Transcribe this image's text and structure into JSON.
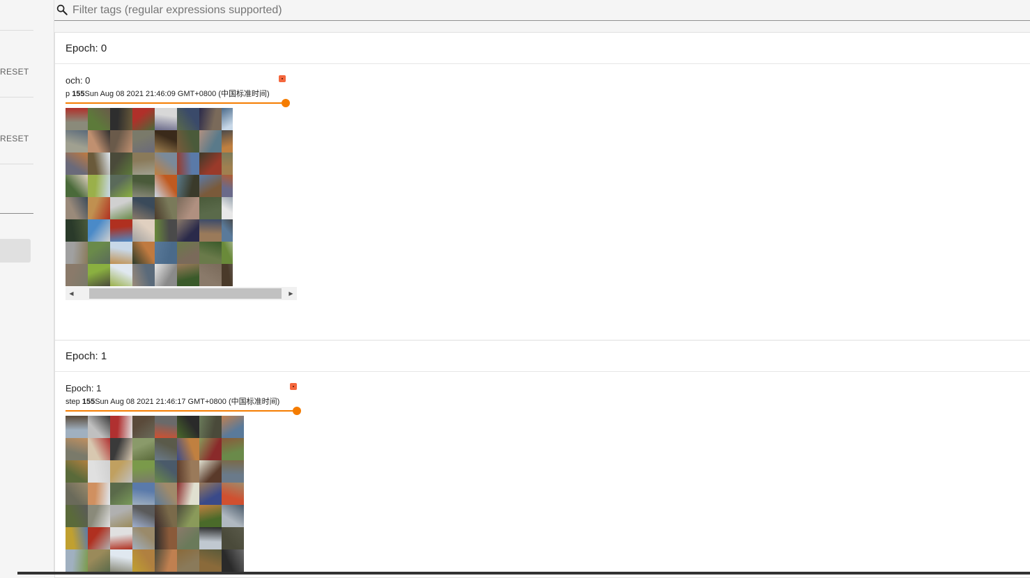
{
  "sidebar": {
    "reset_1": "RESET",
    "reset_2": "RESET"
  },
  "search": {
    "placeholder": "Filter tags (regular expressions supported)"
  },
  "groups": [
    {
      "header": "Epoch: 0",
      "card": {
        "title": "och: 0",
        "step_label": "p",
        "step_value": "155",
        "timestamp": "Sun Aug 08 2021 21:46:09 GMT+0800 (中国标准时间)",
        "slider_fraction": 1.0
      }
    },
    {
      "header": "Epoch: 1",
      "card": {
        "title": "Epoch: 1",
        "step_label": "step",
        "step_value": "155",
        "timestamp": "Sun Aug 08 2021 21:46:17 GMT+0800 (中国标准时间)",
        "slider_fraction": 1.0
      }
    }
  ],
  "icons": {
    "search": "search-icon",
    "fullscreen": "fullscreen-icon",
    "scroll_left": "scroll-left-arrow",
    "scroll_right": "scroll-right-arrow"
  },
  "colors": {
    "accent": "#f57c00",
    "fullscreen_button": "#f4673d"
  },
  "image_palette_0": [
    "#8a8a7a",
    "#5d7a3a",
    "#2e2e2e",
    "#b0302a",
    "#d8d8d8",
    "#3a4a6a",
    "#7a6a5a",
    "#c8d8e8",
    "#a0a090",
    "#c09070",
    "#6a5a4a",
    "#7a7a6a",
    "#3a2a1a",
    "#4a5a3a",
    "#5a7a8a",
    "#c08040",
    "#6a6a7a",
    "#6a5a3a",
    "#4a4a3a",
    "#8a7a5a",
    "#7a8a9a",
    "#5a7aa8",
    "#9a3a2a",
    "#a08050",
    "#4a6a3a",
    "#9ab04a",
    "#5a6a5a",
    "#4a5a3a",
    "#c05a20",
    "#3a3a2a",
    "#7a5a3a",
    "#6a6a8a",
    "#9a8a7a",
    "#c09050",
    "#d0d0d0",
    "#3a4a5a",
    "#7a7a5a",
    "#b09080",
    "#5a6a4a",
    "#e8e8e8",
    "#2a3a2a",
    "#4a8ac8",
    "#b03020",
    "#e0d0c0",
    "#4a4a4a",
    "#2a2a4a",
    "#9a7a5a",
    "#5a7a9a",
    "#a0a0a0",
    "#6a8a4a",
    "#c8d8e8",
    "#c07a40",
    "#4a6a8a",
    "#7a6a5a",
    "#6a7a4a",
    "#6a8a3a",
    "#8a7a6a",
    "#8ab040",
    "#e0e8f0",
    "#5a6a7a",
    "#8a8a8a",
    "#3a5a2a",
    "#8a7a6a",
    "#4a3a2a"
  ],
  "image_palette_1": [
    "#a0b0c0",
    "#c0c0c0",
    "#b03030",
    "#5a4a3a",
    "#6a6a6a",
    "#2a2a2a",
    "#4a4a3a",
    "#5a7a9a",
    "#7a7a6a",
    "#d8c8b0",
    "#3a3a3a",
    "#8a9a6a",
    "#5a5a4a",
    "#c08040",
    "#8a2a2a",
    "#6a8a4a",
    "#5a6a3a",
    "#e0e0e0",
    "#c0a060",
    "#7a9a4a",
    "#4a5a6a",
    "#9a7a5a",
    "#5a3a2a",
    "#6a7a8a",
    "#6a6a5a",
    "#d09060",
    "#5a6a4a",
    "#5a7aaa",
    "#a08a6a",
    "#e0e0d0",
    "#3a4a8a",
    "#d05030",
    "#5a6a3a",
    "#8a8a7a",
    "#b0b0b0",
    "#5a5a5a",
    "#7a6a4a",
    "#8a9a5a",
    "#4a6a2a",
    "#b0b8c0",
    "#c0a030",
    "#b03020",
    "#e0e0e0",
    "#9a8a6a",
    "#8a5a3a",
    "#6a7a5a",
    "#c0c8d0",
    "#4a4a3a",
    "#a0b0c0",
    "#9a8a5a",
    "#e0e8f0",
    "#b08040",
    "#c08050",
    "#8a7a5a",
    "#8a6a3a",
    "#2a2a2a",
    "#a0b0d0",
    "#7a9a5a",
    "#d0d0d0",
    "#c09060",
    "#a07a4a",
    "#5a5a3a",
    "#8a7a6a",
    "#3a2a2a"
  ]
}
